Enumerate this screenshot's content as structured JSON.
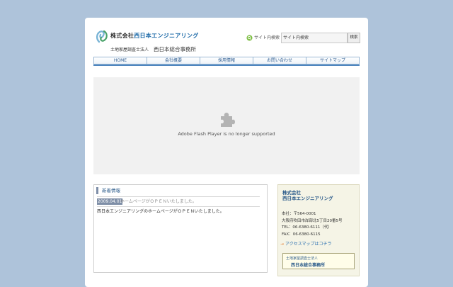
{
  "header": {
    "company_prefix": "株式会社",
    "company_main": "西日本エンジニアリング",
    "sub_prefix": "土地家屋調査士法人",
    "sub_office": "西日本総合事務所"
  },
  "search": {
    "label": "サイト内検索",
    "value": "サイト内検索",
    "button": "検索"
  },
  "nav": {
    "items": [
      {
        "label": "HOME"
      },
      {
        "label": "会社概要"
      },
      {
        "label": "採用情報"
      },
      {
        "label": "お問い合わせ"
      },
      {
        "label": "サイトマップ"
      }
    ]
  },
  "flash": {
    "message": "Adobe Flash Player is no longer supported"
  },
  "news": {
    "heading": "新着情報",
    "date": "2009.04.01",
    "title": "ホームページがＯＰＥＮいたしました。",
    "body": "西日本エンジニアリングのホームページがＯＰＥＮいたしました。"
  },
  "company_box": {
    "name_line1": "株式会社",
    "name_line2": "西日本エンジニアリング",
    "address_line1": "本社：〒564-0001",
    "address_line2": "大阪府吹田市岸部北5丁目20番5号",
    "tel": "TEL：06-6380-6111（代）",
    "fax": "FAX：06-6380-6115",
    "map_link": "アクセスマップはコチラ",
    "office_line1": "土地家屋調査士法人",
    "office_line2": "西日本総合事務所"
  },
  "colors": {
    "background": "#aec3da",
    "accent": "#2a5a8a",
    "nav_border": "#9ab7d3"
  }
}
